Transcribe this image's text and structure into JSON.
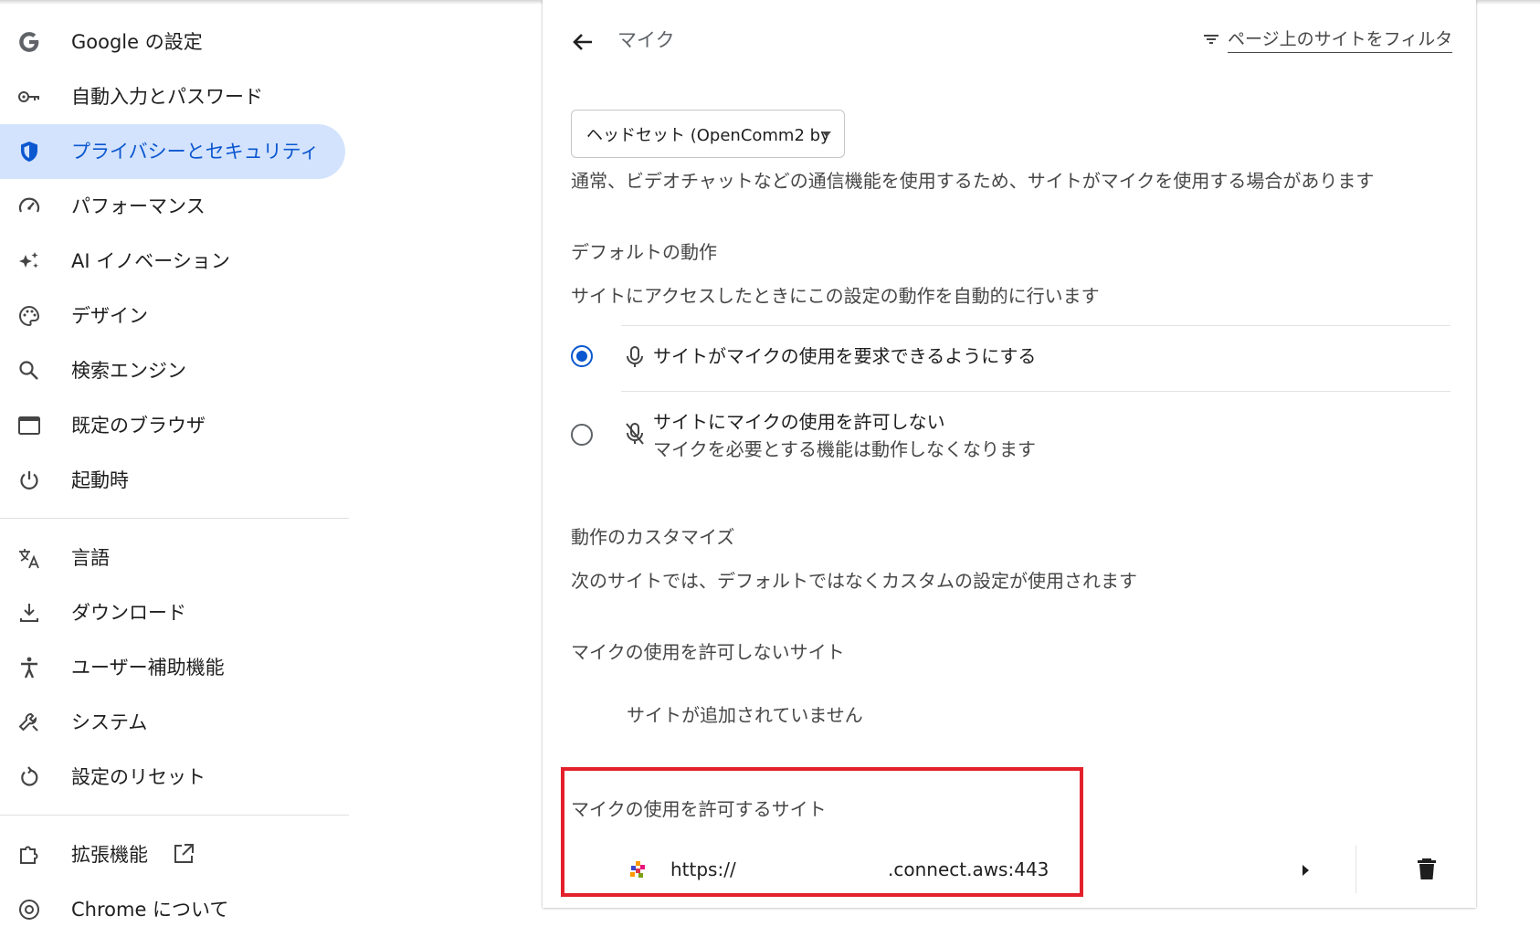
{
  "sidebar": {
    "items": [
      {
        "label": "Google の設定",
        "icon": "google-g-icon"
      },
      {
        "label": "自動入力とパスワード",
        "icon": "key-icon"
      },
      {
        "label": "プライバシーとセキュリティ",
        "icon": "shield-icon",
        "active": true
      },
      {
        "label": "パフォーマンス",
        "icon": "speedometer-icon"
      },
      {
        "label": "AI イノベーション",
        "icon": "sparkle-icon"
      },
      {
        "label": "デザイン",
        "icon": "palette-icon"
      },
      {
        "label": "検索エンジン",
        "icon": "search-icon"
      },
      {
        "label": "既定のブラウザ",
        "icon": "browser-window-icon"
      },
      {
        "label": "起動時",
        "icon": "power-icon"
      },
      {
        "label": "言語",
        "icon": "translate-icon"
      },
      {
        "label": "ダウンロード",
        "icon": "download-icon"
      },
      {
        "label": "ユーザー補助機能",
        "icon": "accessibility-icon"
      },
      {
        "label": "システム",
        "icon": "wrench-icon"
      },
      {
        "label": "設定のリセット",
        "icon": "reset-icon"
      },
      {
        "label": "拡張機能",
        "icon": "puzzle-icon",
        "external_icon": "open-in-new-icon"
      },
      {
        "label": "Chrome について",
        "icon": "chrome-icon"
      }
    ]
  },
  "main": {
    "page_title": "マイク",
    "filter_label": "ページ上のサイトをフィルタ",
    "device_select": "ヘッドセット (OpenComm2 by",
    "device_description": "通常、ビデオチャットなどの通信機能を使用するため、サイトがマイクを使用する場合があります",
    "default_behavior": {
      "heading": "デフォルトの動作",
      "description": "サイトにアクセスしたときにこの設定の動作を自動的に行います",
      "options": [
        {
          "label": "サイトがマイクの使用を要求できるようにする",
          "icon": "mic-icon",
          "checked": true
        },
        {
          "label": "サイトにマイクの使用を許可しない",
          "sublabel": "マイクを必要とする機能は動作しなくなります",
          "icon": "mic-off-icon",
          "checked": false
        }
      ]
    },
    "custom_behavior": {
      "heading": "動作のカスタマイズ",
      "description": "次のサイトでは、デフォルトではなくカスタムの設定が使用されます"
    },
    "blocked": {
      "heading": "マイクの使用を許可しないサイト",
      "empty_text": "サイトが追加されていません"
    },
    "allowed": {
      "heading": "マイクの使用を許可するサイト",
      "sites": [
        {
          "url_prefix": "https://",
          "url_suffix": ".connect.aws:443"
        }
      ]
    }
  },
  "colors": {
    "accent": "#0b57d0",
    "active_nav_bg": "#d3e3fd",
    "highlight_box": "#e3202b"
  }
}
